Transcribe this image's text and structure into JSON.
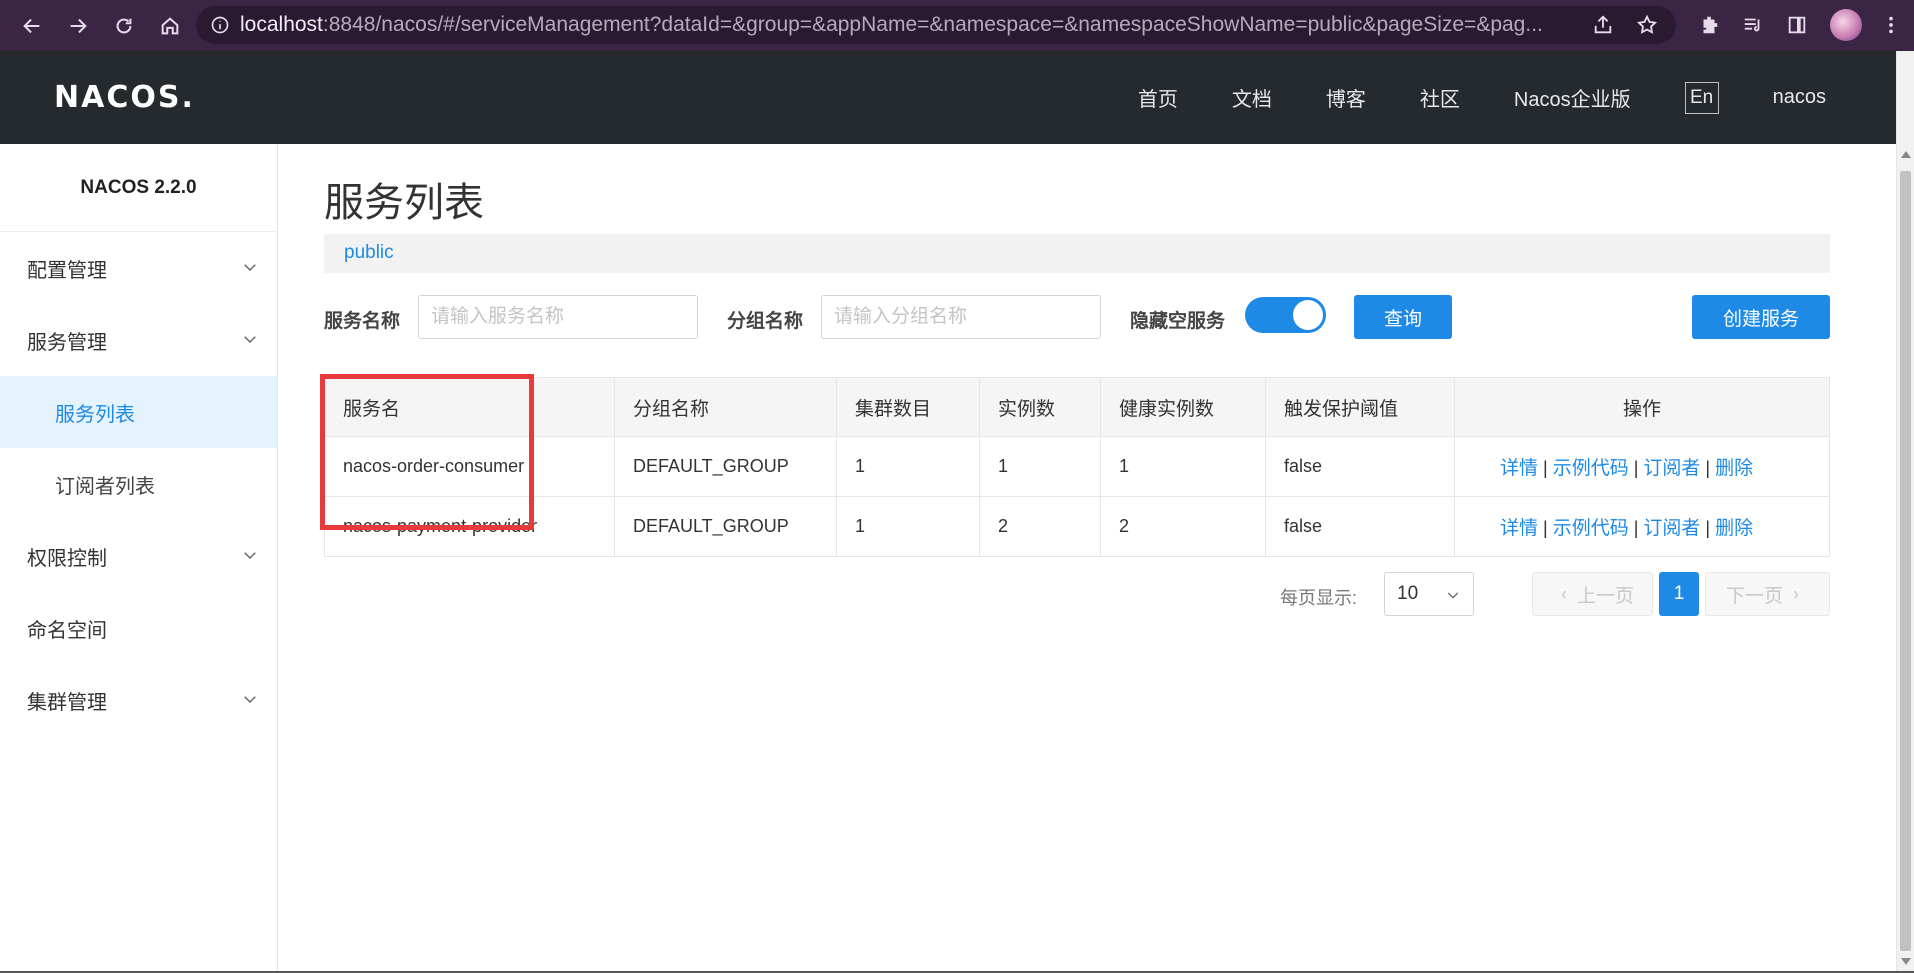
{
  "browser": {
    "url_host": "localhost",
    "url_rest": ":8848/nacos/#/serviceManagement?dataId=&group=&appName=&namespace=&namespaceShowName=public&pageSize=&pag..."
  },
  "header": {
    "logo": "NACOS.",
    "nav": [
      "首页",
      "文档",
      "博客",
      "社区",
      "Nacos企业版"
    ],
    "lang": "En",
    "user": "nacos"
  },
  "sidebar": {
    "version": "NACOS 2.2.0",
    "items": [
      {
        "label": "配置管理"
      },
      {
        "label": "服务管理"
      },
      {
        "label": "服务列表"
      },
      {
        "label": "订阅者列表"
      },
      {
        "label": "权限控制"
      },
      {
        "label": "命名空间"
      },
      {
        "label": "集群管理"
      }
    ]
  },
  "main": {
    "title": "服务列表",
    "namespace": "public",
    "filters": {
      "service_name_label": "服务名称",
      "service_name_placeholder": "请输入服务名称",
      "group_name_label": "分组名称",
      "group_name_placeholder": "请输入分组名称",
      "hide_empty_label": "隐藏空服务",
      "hide_empty_on": true,
      "query_button": "查询",
      "create_button": "创建服务"
    },
    "table": {
      "headers": [
        "服务名",
        "分组名称",
        "集群数目",
        "实例数",
        "健康实例数",
        "触发保护阈值",
        "操作"
      ],
      "rows": [
        {
          "name": "nacos-order-consumer",
          "group": "DEFAULT_GROUP",
          "clusters": "1",
          "instances": "1",
          "healthy": "1",
          "threshold": "false"
        },
        {
          "name": "nacos-payment-provider",
          "group": "DEFAULT_GROUP",
          "clusters": "1",
          "instances": "2",
          "healthy": "2",
          "threshold": "false"
        }
      ],
      "ops": [
        "详情",
        "示例代码",
        "订阅者",
        "删除"
      ],
      "op_separator": "|"
    },
    "pagination": {
      "page_size_label": "每页显示:",
      "page_size": "10",
      "prev": "上一页",
      "next": "下一页",
      "current_page": "1"
    }
  },
  "colors": {
    "accent": "#1f8ae6",
    "header_bg": "#252a2f",
    "highlight": "#e83a3d"
  }
}
